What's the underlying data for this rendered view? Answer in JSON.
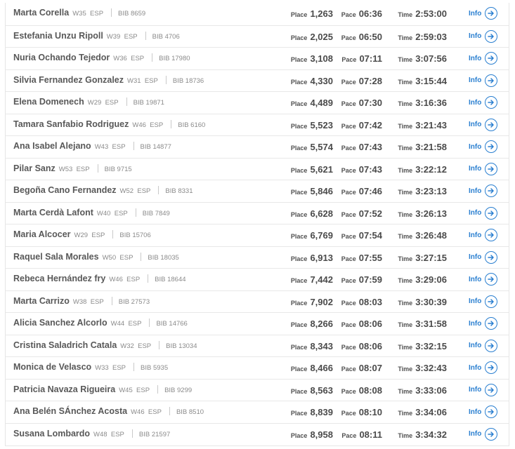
{
  "labels": {
    "place": "Place",
    "pace": "Pace",
    "time": "Time",
    "info": "Info"
  },
  "rows": [
    {
      "name": "Marta Corella",
      "cat": "W35",
      "country": "ESP",
      "bib": "BIB 8659",
      "place": "1,263",
      "pace": "06:36",
      "time": "2:53:00"
    },
    {
      "name": "Estefania Unzu Ripoll",
      "cat": "W39",
      "country": "ESP",
      "bib": "BIB 4706",
      "place": "2,025",
      "pace": "06:50",
      "time": "2:59:03"
    },
    {
      "name": "Nuria Ochando Tejedor",
      "cat": "W36",
      "country": "ESP",
      "bib": "BIB 17980",
      "place": "3,108",
      "pace": "07:11",
      "time": "3:07:56"
    },
    {
      "name": "Silvia Fernandez Gonzalez",
      "cat": "W31",
      "country": "ESP",
      "bib": "BIB 18736",
      "place": "4,330",
      "pace": "07:28",
      "time": "3:15:44"
    },
    {
      "name": "Elena Domenech",
      "cat": "W29",
      "country": "ESP",
      "bib": "BIB 19871",
      "place": "4,489",
      "pace": "07:30",
      "time": "3:16:36"
    },
    {
      "name": "Tamara Sanfabio Rodriguez",
      "cat": "W46",
      "country": "ESP",
      "bib": "BIB 6160",
      "place": "5,523",
      "pace": "07:42",
      "time": "3:21:43"
    },
    {
      "name": "Ana Isabel Alejano",
      "cat": "W43",
      "country": "ESP",
      "bib": "BIB 14877",
      "place": "5,574",
      "pace": "07:43",
      "time": "3:21:58"
    },
    {
      "name": "Pilar Sanz",
      "cat": "W53",
      "country": "ESP",
      "bib": "BIB 9715",
      "place": "5,621",
      "pace": "07:43",
      "time": "3:22:12"
    },
    {
      "name": "Begoña Cano Fernandez",
      "cat": "W52",
      "country": "ESP",
      "bib": "BIB 8331",
      "place": "5,846",
      "pace": "07:46",
      "time": "3:23:13"
    },
    {
      "name": "Marta Cerdà Lafont",
      "cat": "W40",
      "country": "ESP",
      "bib": "BIB 7849",
      "place": "6,628",
      "pace": "07:52",
      "time": "3:26:13"
    },
    {
      "name": "Maria Alcocer",
      "cat": "W29",
      "country": "ESP",
      "bib": "BIB 15706",
      "place": "6,769",
      "pace": "07:54",
      "time": "3:26:48"
    },
    {
      "name": "Raquel Sala Morales",
      "cat": "W50",
      "country": "ESP",
      "bib": "BIB 18035",
      "place": "6,913",
      "pace": "07:55",
      "time": "3:27:15"
    },
    {
      "name": "Rebeca Hernández fry",
      "cat": "W46",
      "country": "ESP",
      "bib": "BIB 18644",
      "place": "7,442",
      "pace": "07:59",
      "time": "3:29:06"
    },
    {
      "name": "Marta Carrizo",
      "cat": "W38",
      "country": "ESP",
      "bib": "BIB 27573",
      "place": "7,902",
      "pace": "08:03",
      "time": "3:30:39"
    },
    {
      "name": "Alicia Sanchez Alcorlo",
      "cat": "W44",
      "country": "ESP",
      "bib": "BIB 14766",
      "place": "8,266",
      "pace": "08:06",
      "time": "3:31:58"
    },
    {
      "name": "Cristina Saladrich Catala",
      "cat": "W32",
      "country": "ESP",
      "bib": "BIB 13034",
      "place": "8,343",
      "pace": "08:06",
      "time": "3:32:15"
    },
    {
      "name": "Monica de Velasco",
      "cat": "W33",
      "country": "ESP",
      "bib": "BIB 5935",
      "place": "8,466",
      "pace": "08:07",
      "time": "3:32:43"
    },
    {
      "name": "Patricia Navaza Rigueira",
      "cat": "W45",
      "country": "ESP",
      "bib": "BIB 9299",
      "place": "8,563",
      "pace": "08:08",
      "time": "3:33:06"
    },
    {
      "name": "Ana Belén SÁnchez Acosta",
      "cat": "W46",
      "country": "ESP",
      "bib": "BIB 8510",
      "place": "8,839",
      "pace": "08:10",
      "time": "3:34:06"
    },
    {
      "name": "Susana Lombardo",
      "cat": "W48",
      "country": "ESP",
      "bib": "BIB 21597",
      "place": "8,958",
      "pace": "08:11",
      "time": "3:34:32"
    }
  ],
  "info_icon": "arrow-right-circle-icon",
  "colors": {
    "accent": "#2a7fd0",
    "text": "#585858",
    "muted": "#8a8a8a",
    "divider": "#e8e8e8"
  }
}
